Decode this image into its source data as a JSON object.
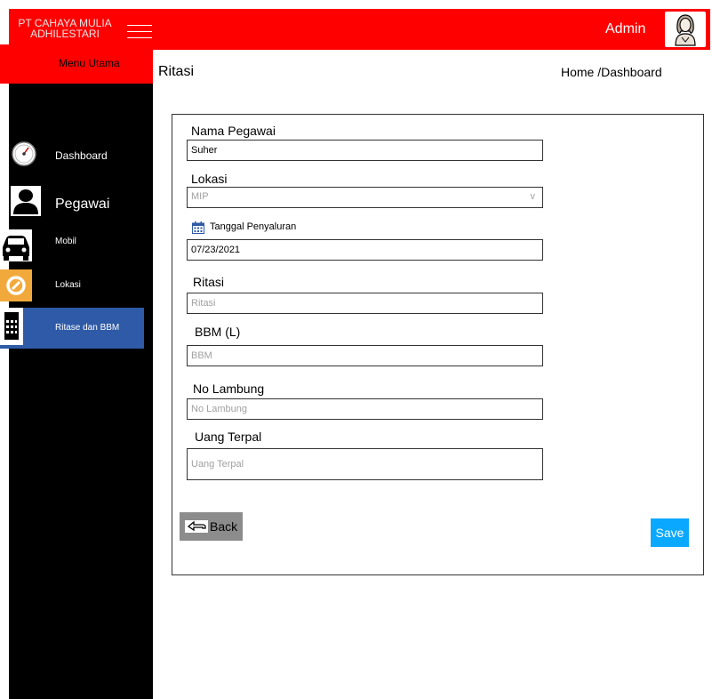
{
  "app": {
    "brand": "PT CAHAYA MULIA\nADHILESTARI",
    "user_label": "Admin"
  },
  "sidebar": {
    "menu_title": "Menu Utama",
    "items": [
      {
        "label": "Dashboard",
        "icon": "speedometer-icon"
      },
      {
        "label": "Pegawai",
        "icon": "person-icon"
      },
      {
        "label": "Mobil",
        "icon": "car-icon"
      },
      {
        "label": "Lokasi",
        "icon": "location-icon"
      },
      {
        "label": "Ritase dan BBM",
        "icon": "calendar-icon",
        "active": true
      }
    ]
  },
  "page": {
    "title": "Ritasi",
    "breadcrumb": "Home /Dashboard"
  },
  "form": {
    "nama_pegawai": {
      "label": "Nama Pegawai",
      "value": "Suher"
    },
    "lokasi": {
      "label": "Lokasi",
      "value": "MIP",
      "chevron": "v"
    },
    "tanggal": {
      "label": "Tanggal Penyaluran",
      "value": "07/23/2021"
    },
    "ritasi": {
      "label": "Ritasi",
      "placeholder": "Ritasi"
    },
    "bbm": {
      "label": "BBM (L)",
      "placeholder": "BBM"
    },
    "no_lambung": {
      "label": "No Lambung",
      "placeholder": "No Lambung"
    },
    "uang_terpal": {
      "label": "Uang Terpal",
      "placeholder": "Uang Terpal"
    }
  },
  "actions": {
    "back_label": "Back",
    "save_label": "Save"
  },
  "colors": {
    "header": "#ff0000",
    "sidebar": "#000000",
    "active_item": "#2e5aa7",
    "save_button": "#0aa8ff",
    "back_button": "#8c8c8c"
  }
}
